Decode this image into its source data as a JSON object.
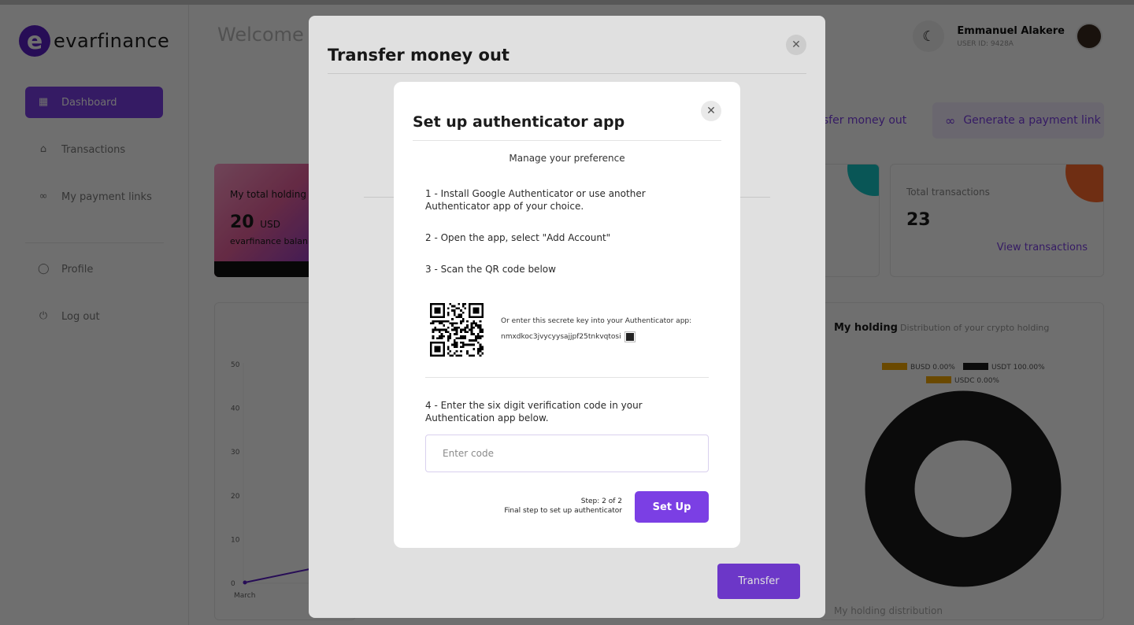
{
  "app": {
    "brand_letter": "e",
    "brand": "evarfinance",
    "welcome": "Welcome"
  },
  "sidebar": {
    "items": [
      {
        "label": "Dashboard",
        "icon": "grid-icon"
      },
      {
        "label": "Transactions",
        "icon": "tag-icon"
      },
      {
        "label": "My payment links",
        "icon": "link-icon"
      },
      {
        "label": "Profile",
        "icon": "user-icon"
      },
      {
        "label": "Log out",
        "icon": "power-icon"
      }
    ]
  },
  "header": {
    "user_name": "Emmanuel Alakere",
    "user_id": "USER ID: 9428A"
  },
  "actions": {
    "transfer_out": "nsfer money out",
    "payment_link": "Generate a payment link"
  },
  "holding_card": {
    "title": "My total holding",
    "value": "20",
    "unit": "USD",
    "sub": "evarfinance balan"
  },
  "transactions_card": {
    "title": "Total transactions",
    "value": "23",
    "link": "View transactions"
  },
  "line_chart": {
    "y_ticks": [
      "50",
      "40",
      "30",
      "20",
      "10",
      "0"
    ],
    "x_label": "March"
  },
  "holding_chart": {
    "title": "My holding",
    "subtitle": "Distribution of your crypto holding",
    "caption": "My holding distribution",
    "legend": [
      {
        "label": "BUSD 0.00%",
        "color": "#f2a900"
      },
      {
        "label": "USDT 100.00%",
        "color": "#1a1a1a"
      },
      {
        "label": "USDC 0.00%",
        "color": "#f2a900"
      }
    ],
    "values": [
      0,
      100,
      0
    ]
  },
  "outer_modal": {
    "title": "Transfer money out",
    "transfer_label": "Transfer"
  },
  "auth_modal": {
    "title": "Set up authenticator app",
    "subtitle": "Manage your preference",
    "step1": "1 - Install Google Authenticator or use another Authenticator app of your choice.",
    "step2": "2 - Open the app, select \"Add Account\"",
    "step3": "3 - Scan the QR code below",
    "secret_label": "Or enter this secrete key into your Authenticator app:",
    "secret_key": "nmxdkoc3jvycyysajjpf25tnkvqtosi",
    "step4": "4 - Enter the six digit verification code in your Authentication app below.",
    "code_placeholder": "Enter code",
    "step_count": "Step: 2 of 2",
    "step_note": "Final step to set up authenticator",
    "submit_label": "Set Up"
  }
}
